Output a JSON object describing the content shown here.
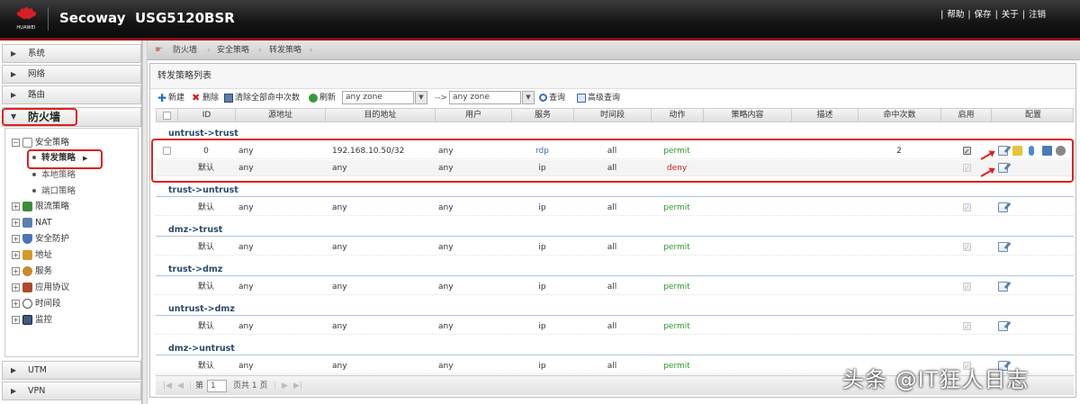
{
  "header": {
    "logo_text": "HUAWEI",
    "brand": "Secoway",
    "model": "USG5120BSR",
    "links": [
      "帮助",
      "保存",
      "关于",
      "注销"
    ]
  },
  "sidebar": {
    "sections": [
      {
        "label": "系统"
      },
      {
        "label": "网络"
      },
      {
        "label": "路由"
      },
      {
        "label": "防火墙"
      }
    ],
    "tree": [
      {
        "label": "安全策略",
        "expanded": true
      },
      {
        "label": "转发策略",
        "selected": true
      },
      {
        "label": "本地策略"
      },
      {
        "label": "端口策略"
      },
      {
        "label": "限流策略"
      },
      {
        "label": "NAT"
      },
      {
        "label": "安全防护"
      },
      {
        "label": "地址"
      },
      {
        "label": "服务"
      },
      {
        "label": "应用协议"
      },
      {
        "label": "时间段"
      },
      {
        "label": "监控"
      }
    ],
    "bottom_sections": [
      {
        "label": "UTM"
      },
      {
        "label": "VPN"
      }
    ]
  },
  "breadcrumb": [
    "防火墙",
    "安全策略",
    "转发策略"
  ],
  "panel": {
    "title": "转发策略列表",
    "toolbar": {
      "new_label": "新建",
      "delete_label": "删除",
      "clear_hits_label": "清除全部命中次数",
      "refresh_label": "刷新",
      "src_zone": "any zone",
      "arrow": "-->",
      "dst_zone": "any zone",
      "query_label": "查询",
      "advanced_query_label": "高级查询"
    },
    "columns": [
      "ID",
      "源地址",
      "目的地址",
      "用户",
      "服务",
      "时间段",
      "动作",
      "策略内容",
      "描述",
      "命中次数",
      "启用",
      "配置"
    ],
    "groups": [
      {
        "name": "untrust->trust",
        "rows": [
          {
            "id": "0",
            "src": "any",
            "dst": "192.168.10.50/32",
            "user": "any",
            "service": "rdp",
            "time": "all",
            "action": "permit",
            "hits": "2",
            "enabled": true,
            "editable_enable": true
          },
          {
            "id": "默认",
            "src": "any",
            "dst": "any",
            "user": "any",
            "service": "ip",
            "time": "all",
            "action": "deny",
            "hits": "",
            "enabled": true,
            "editable_enable": false
          }
        ]
      },
      {
        "name": "trust->untrust",
        "rows": [
          {
            "id": "默认",
            "src": "any",
            "dst": "any",
            "user": "any",
            "service": "ip",
            "time": "all",
            "action": "permit",
            "hits": "",
            "enabled": true,
            "editable_enable": false
          }
        ]
      },
      {
        "name": "dmz->trust",
        "rows": [
          {
            "id": "默认",
            "src": "any",
            "dst": "any",
            "user": "any",
            "service": "ip",
            "time": "all",
            "action": "permit",
            "hits": "",
            "enabled": true,
            "editable_enable": false
          }
        ]
      },
      {
        "name": "trust->dmz",
        "rows": [
          {
            "id": "默认",
            "src": "any",
            "dst": "any",
            "user": "any",
            "service": "ip",
            "time": "all",
            "action": "permit",
            "hits": "",
            "enabled": true,
            "editable_enable": false
          }
        ]
      },
      {
        "name": "untrust->dmz",
        "rows": [
          {
            "id": "默认",
            "src": "any",
            "dst": "any",
            "user": "any",
            "service": "ip",
            "time": "all",
            "action": "permit",
            "hits": "",
            "enabled": true,
            "editable_enable": false
          }
        ]
      },
      {
        "name": "dmz->untrust",
        "rows": [
          {
            "id": "默认",
            "src": "any",
            "dst": "any",
            "user": "any",
            "service": "ip",
            "time": "all",
            "action": "permit",
            "hits": "",
            "enabled": true,
            "editable_enable": false
          }
        ]
      }
    ],
    "pager": {
      "page_prefix": "第",
      "page_value": "1",
      "page_suffix": "页共 1 页"
    }
  },
  "watermark": "头条 @IT狂人日志",
  "colors": {
    "accent_red": "#e02020",
    "header_dark": "#141414",
    "header_line": "#8e0b0b",
    "permit": "#2e9a2e",
    "deny": "#d02020"
  }
}
